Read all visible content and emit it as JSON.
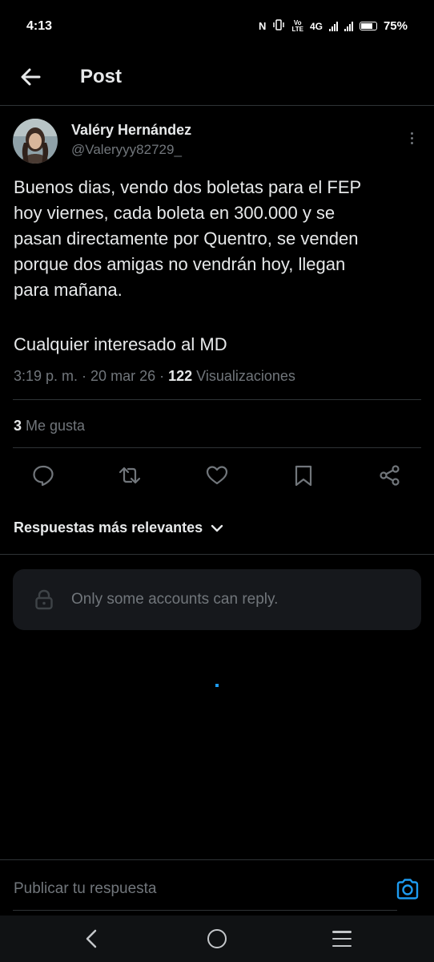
{
  "status_bar": {
    "time": "4:13",
    "network": "4G",
    "battery": "75%"
  },
  "header": {
    "title": "Post",
    "back_icon": "arrow-left-icon"
  },
  "post": {
    "author_name": "Valéry Hernández",
    "author_handle": "@Valeryyy82729_",
    "text_paragraph_1": "Buenos dias, vendo dos boletas para el FEP\nhoy viernes, cada boleta en 300.000 y se\npasan directamente por Quentro, se venden\nporque dos amigas no vendrán hoy, llegan\npara mañana.",
    "text_paragraph_2": "Cualquier interesado al MD",
    "time": "3:19 p. m.",
    "separator": "·",
    "date": "20 mar 26",
    "views_count": "122",
    "views_label": "Visualizaciones",
    "likes_count": "3",
    "likes_label": "Me gusta"
  },
  "actions": {
    "reply_icon": "reply-icon",
    "repost_icon": "repost-icon",
    "like_icon": "heart-icon",
    "bookmark_icon": "bookmark-icon",
    "share_icon": "share-icon"
  },
  "replies": {
    "sort_label": "Respuestas más relevantes",
    "restricted_text": "Only some accounts can reply."
  },
  "compose": {
    "placeholder": "Publicar tu respuesta"
  },
  "colors": {
    "background": "#000000",
    "text": "#e7e9ea",
    "muted": "#71767b",
    "accent": "#1d9bf0",
    "border": "#2f3336"
  }
}
